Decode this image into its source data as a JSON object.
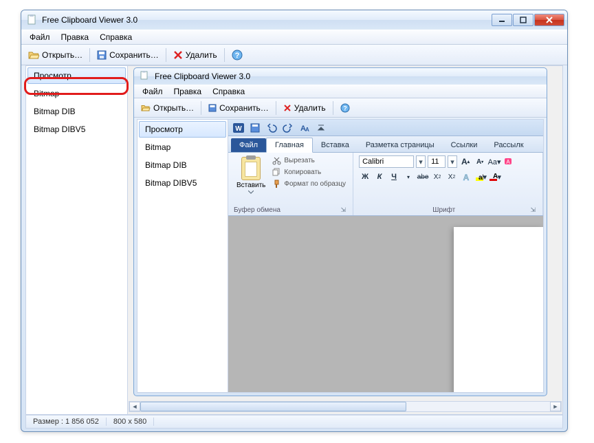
{
  "window": {
    "title": "Free Clipboard Viewer 3.0"
  },
  "menu": {
    "file": "Файл",
    "edit": "Правка",
    "help": "Справка"
  },
  "toolbar": {
    "open": "Открыть…",
    "save": "Сохранить…",
    "delete": "Удалить"
  },
  "sidebar": {
    "items": [
      {
        "label": "Просмотр"
      },
      {
        "label": "Bitmap"
      },
      {
        "label": "Bitmap DIB"
      },
      {
        "label": "Bitmap DIBV5"
      }
    ]
  },
  "inner": {
    "title": "Free Clipboard Viewer 3.0",
    "menu": {
      "file": "Файл",
      "edit": "Правка",
      "help": "Справка"
    },
    "toolbar": {
      "open": "Открыть…",
      "save": "Сохранить…",
      "delete": "Удалить"
    },
    "sidebar": {
      "items": [
        {
          "label": "Просмотр"
        },
        {
          "label": "Bitmap"
        },
        {
          "label": "Bitmap DIB"
        },
        {
          "label": "Bitmap DIBV5"
        }
      ]
    }
  },
  "word": {
    "tabs": {
      "file": "Файл",
      "home": "Главная",
      "insert": "Вставка",
      "layout": "Разметка страницы",
      "refs": "Ссылки",
      "mail": "Рассылк"
    },
    "clipboard": {
      "paste": "Вставить",
      "cut": "Вырезать",
      "copy": "Копировать",
      "formatpainter": "Формат по образцу",
      "group": "Буфер обмена"
    },
    "font": {
      "name": "Calibri",
      "size": "11",
      "bold": "Ж",
      "italic": "К",
      "underline": "Ч",
      "strike": "abe",
      "group": "Шрифт"
    }
  },
  "status": {
    "size_label": "Размер : 1 856 052",
    "dims": "800 x 580"
  }
}
